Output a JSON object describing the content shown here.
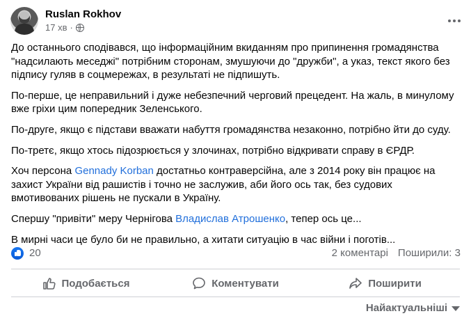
{
  "post": {
    "author": "Ruslan Rokhov",
    "time": "17 хв",
    "paragraphs": [
      {
        "parts": [
          {
            "text": "До останнього сподівався, що інформаційним вкиданням про припинення громадянства \"надсилають меседжі\" потрібним сторонам, змушуючи до \"дружби\", а указ, текст якого без підпису гуляв в соцмережах, в результаті не підпишуть."
          }
        ]
      },
      {
        "parts": [
          {
            "text": "По-перше, це неправильний і дуже небезпечний черговий прецедент. На жаль, в минулому вже гріхи цим попередник Зеленського."
          }
        ]
      },
      {
        "parts": [
          {
            "text": "По-друге, якщо є підстави вважати набуття громадянства незаконно, потрібно йти до суду."
          }
        ]
      },
      {
        "parts": [
          {
            "text": "По-третє, якщо хтось підозрюється у злочинах, потрібно відкривати справу в ЄРДР."
          }
        ]
      },
      {
        "parts": [
          {
            "text": "Хоч персона "
          },
          {
            "text": "Gennady Korban",
            "link": true
          },
          {
            "text": " достатньо контраверсійна, але з 2014 року він працює на захист України від рашистів і точно не заслужив, аби його ось так, без судових вмотивованих рішень не пускали в Україну."
          }
        ]
      },
      {
        "parts": [
          {
            "text": "Спершу \"привіти\" меру Чернігова "
          },
          {
            "text": "Владислав Атрошенко",
            "link": true
          },
          {
            "text": ", тепер ось це..."
          }
        ]
      },
      {
        "parts": [
          {
            "text": "В мирні часи це було би не правильно, а хитати ситуацію в час війни і поготів..."
          }
        ]
      }
    ]
  },
  "stats": {
    "reactions": "20",
    "comments": "2 коментарі",
    "shares": "Поширили: 3"
  },
  "actions": {
    "like": "Подобається",
    "comment": "Коментувати",
    "share": "Поширити"
  },
  "sort_label": "Найактуальніші",
  "icons": {
    "avatar": "avatar",
    "audience": "globe-icon",
    "menu": "more-options-icon",
    "reaction": "like-reaction-icon",
    "like": "thumbs-up-icon",
    "comment": "comment-bubble-icon",
    "share": "share-arrow-icon",
    "sort": "chevron-down-icon"
  },
  "colors": {
    "link": "#216fdb",
    "secondary_text": "#65676b",
    "like_blue": "#1877f2"
  }
}
